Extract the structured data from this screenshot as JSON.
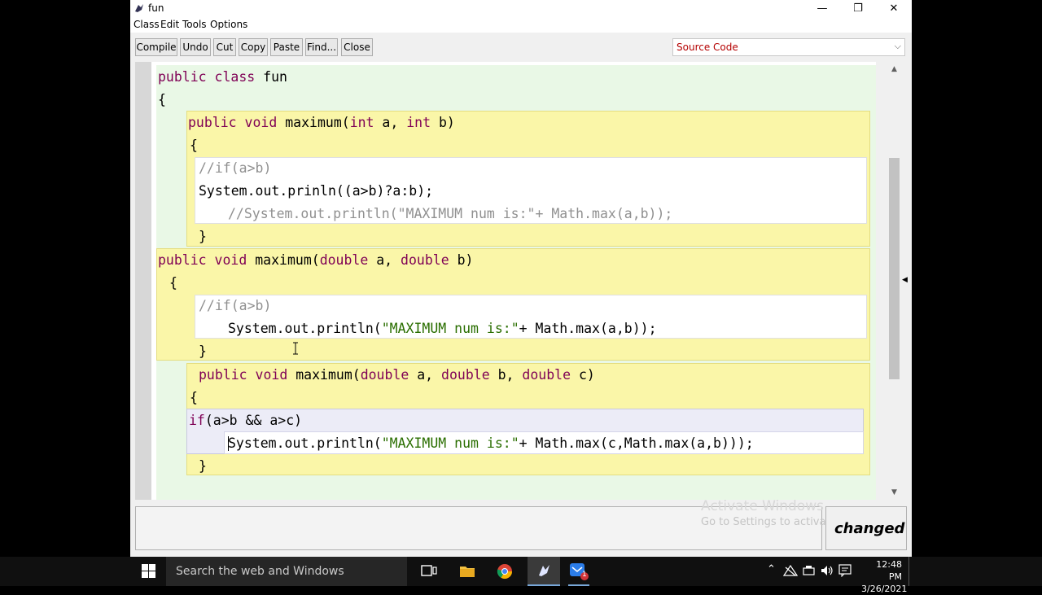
{
  "window": {
    "title": "fun",
    "min": "—",
    "max": "❐",
    "close": "✕"
  },
  "menu": [
    "Class",
    "Edit",
    "Tools",
    "Options"
  ],
  "toolbar": [
    "Compile",
    "Undo",
    "Cut",
    "Copy",
    "Paste",
    "Find...",
    "Close"
  ],
  "view_selector": {
    "value": "Source Code"
  },
  "code": {
    "l1": {
      "kw": "public class",
      "rest": " fun"
    },
    "l2": "{",
    "l3": {
      "kw1": "public void",
      "m": " maximum(",
      "kw2": "int",
      "a": " a, ",
      "kw3": "int",
      "b": " b)"
    },
    "l4": "{",
    "l5": "//if(a>b)",
    "l6": "System.out.prinln((a>b)?a:b);",
    "l7": "//System.out.println(\"MAXIMUM num is:\"+ Math.max(a,b));",
    "l8": "}",
    "l9": {
      "kw1": "public void",
      "m": " maximum(",
      "kw2": "double",
      "a": " a, ",
      "kw3": "double",
      "b": " b)"
    },
    "l10": "{",
    "l11": "//if(a>b)",
    "l12": {
      "pre": "System.out.println(",
      "str": "\"MAXIMUM num is:\"",
      "post": "+ Math.max(a,b));"
    },
    "l13": "}",
    "l14": {
      "kw1": "public void",
      "m": " maximum(",
      "kw2": "double",
      "a": " a, ",
      "kw3": "double",
      "b": " b, ",
      "kw4": "double",
      "c": " c)"
    },
    "l15": "{",
    "l16": {
      "kw": "if",
      "rest": "(a>b && a>c)"
    },
    "l17": {
      "pre": "System.out.println(",
      "str": "\"MAXIMUM num is:\"",
      "post": "+ Math.max(c,Math.max(a,b)));"
    },
    "l18": "}"
  },
  "status": "changed",
  "watermark": {
    "line1": "Activate Windows",
    "line2": "Go to Settings to activate Windows."
  },
  "taskbar": {
    "search_placeholder": "Search the web and Windows",
    "time": "12:48 PM",
    "date": "3/26/2021",
    "mail_badge": "1"
  },
  "colors": {
    "class_scope": "#e9f8e6",
    "method_scope": "#faf6a8",
    "body_scope": "#ffffff",
    "if_scope": "#ececf7",
    "keyword": "#7f0055",
    "comment": "#909090",
    "string": "#2a6e00"
  }
}
